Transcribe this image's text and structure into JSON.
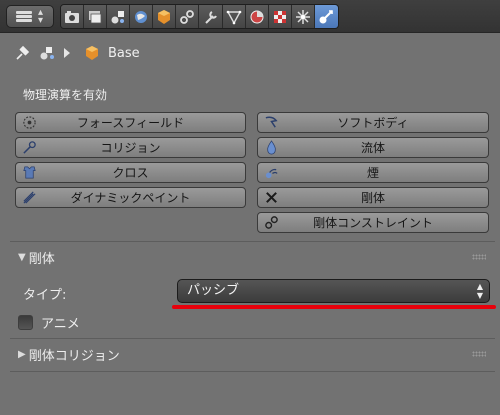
{
  "header": {
    "tabs": [
      {
        "icon": "render-icon",
        "active": false
      },
      {
        "icon": "render-layers-icon",
        "active": false
      },
      {
        "icon": "scene-icon",
        "active": false
      },
      {
        "icon": "world-icon",
        "active": false
      },
      {
        "icon": "object-icon",
        "active": false
      },
      {
        "icon": "constraints-icon",
        "active": false
      },
      {
        "icon": "modifiers-icon",
        "active": false
      },
      {
        "icon": "data-icon",
        "active": false
      },
      {
        "icon": "material-icon",
        "active": false
      },
      {
        "icon": "texture-icon",
        "active": false
      },
      {
        "icon": "particles-icon",
        "active": false
      },
      {
        "icon": "physics-icon",
        "active": true
      }
    ]
  },
  "context": {
    "object_name": "Base"
  },
  "physics": {
    "title": "物理演算を有効",
    "buttons_left": [
      {
        "label": "フォースフィールド",
        "icon": "force-field-icon"
      },
      {
        "label": "コリジョン",
        "icon": "collision-icon"
      },
      {
        "label": "クロス",
        "icon": "cloth-icon"
      },
      {
        "label": "ダイナミックペイント",
        "icon": "dynamic-paint-icon"
      }
    ],
    "buttons_right": [
      {
        "label": "ソフトボディ",
        "icon": "soft-body-icon"
      },
      {
        "label": "流体",
        "icon": "fluid-icon"
      },
      {
        "label": "煙",
        "icon": "smoke-icon"
      },
      {
        "label": "剛体",
        "icon": "remove-x-icon"
      },
      {
        "label": "剛体コンストレイント",
        "icon": "rigid-body-constraint-icon"
      }
    ]
  },
  "rigid_body": {
    "title": "剛体",
    "type_label": "タイプ:",
    "type_value": "パッシブ",
    "animated_label": "アニメ",
    "animated_checked": false
  },
  "rigid_body_collision": {
    "title": "剛体コリジョン"
  },
  "colors": {
    "highlight_underline": "#e8000b",
    "active_tab": "#5a86c8"
  }
}
